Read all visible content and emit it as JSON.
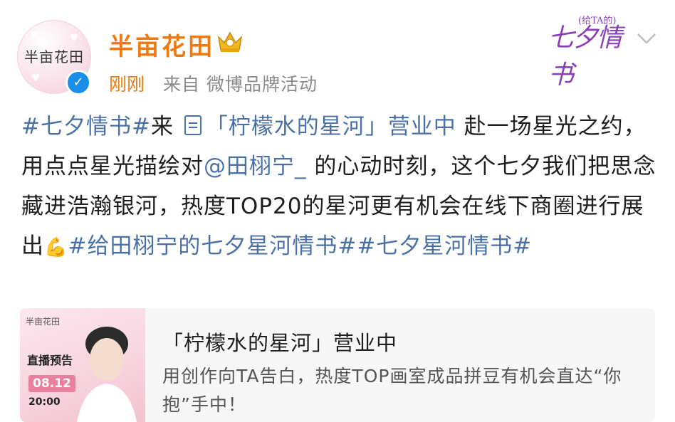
{
  "header": {
    "avatar_text": "半亩花田",
    "username": "半亩花田",
    "time": "刚刚",
    "source": "来自 微博品牌活动",
    "topic_logo_main": "七夕情书",
    "topic_logo_small": "(给TA的)"
  },
  "post": {
    "tag1": "#七夕情书#",
    "t1": "来",
    "link1": "「柠檬水的星河」营业中",
    "t2": " 赴一场星光之约，用点点星光描绘对",
    "mention": "@田栩宁_",
    "t3": " 的心动时刻，这个七夕我们把思念藏进浩瀚银河，热度TOP20的星河更有机会在线下商圈进行展出",
    "tag2": "#给田栩宁的七夕星河情书#",
    "tag3": "#七夕星河情书#"
  },
  "card": {
    "thumb_brand": "半亩花田",
    "thumb_live": "直播预告",
    "thumb_date": "08.12",
    "thumb_time": "20:00",
    "title": "「柠檬水的星河」营业中",
    "desc": "用创作向TA告白，热度TOP画室成品拼豆有机会直达“你抱”手中！"
  },
  "colors": {
    "username": "#f07a10",
    "link": "#4a70a8",
    "verified": "#1a8fe8",
    "topic": "#8a3fb8"
  }
}
